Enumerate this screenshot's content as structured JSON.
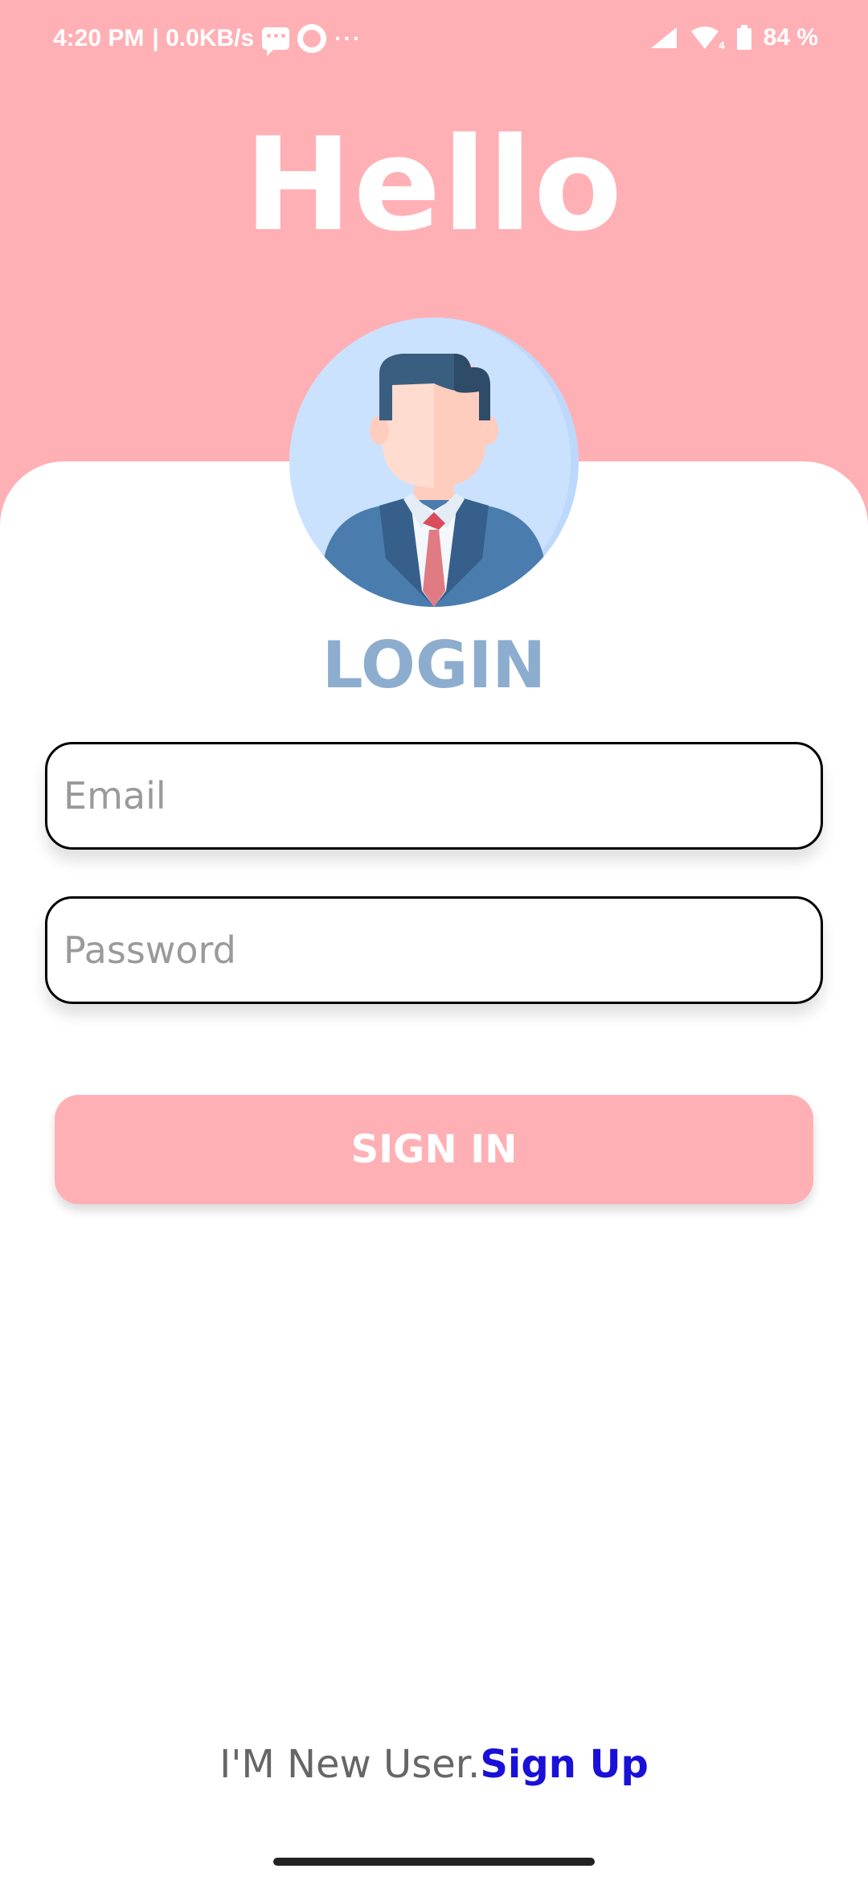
{
  "status_bar": {
    "time": "4:20 PM",
    "network_speed": "| 0.0KB/s",
    "more": "···",
    "battery": "84 %",
    "icons": [
      "message-icon",
      "ring-icon",
      "signal-icon",
      "wifi-icon",
      "battery-icon"
    ]
  },
  "header": {
    "title": "Hello",
    "background_color": "#FFB0B5"
  },
  "login": {
    "heading": "LOGIN",
    "heading_color": "#8DADCF",
    "email_placeholder": "Email",
    "email_value": "",
    "password_placeholder": "Password",
    "password_value": "",
    "signin_label": "SIGN IN"
  },
  "footer": {
    "prompt": "I'M New User.",
    "signup_label": "Sign Up",
    "link_color": "#1A10D8"
  }
}
